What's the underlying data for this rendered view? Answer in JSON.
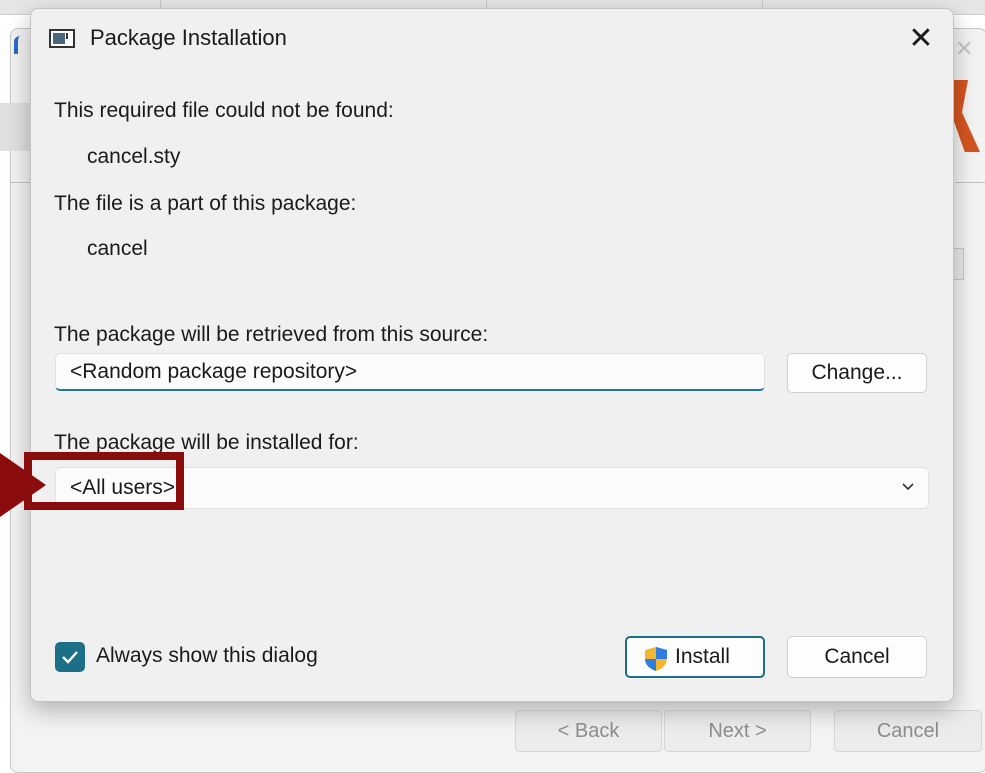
{
  "background_window": {
    "buttons": {
      "back": "< Back",
      "next": "Next >",
      "cancel": "Cancel"
    }
  },
  "dialog": {
    "title": "Package Installation",
    "close_label": "✕",
    "missing_file_label": "This required file could not be found:",
    "missing_file": "cancel.sty",
    "package_label": "The file is a part of this package:",
    "package_name": "cancel",
    "source_label": "The package will be retrieved from this source:",
    "source_value": "<Random package repository>",
    "change_button": "Change...",
    "install_for_label": "The package will be installed for:",
    "install_for_value": "<All users>",
    "always_show_label": "Always show this dialog",
    "always_show_checked": true,
    "install_button": "Install",
    "cancel_button": "Cancel"
  },
  "colors": {
    "accent": "#1b6f86",
    "highlight": "#8b0c0c"
  },
  "icons": [
    "window-icon",
    "close-icon",
    "chevron-down-icon",
    "checkmark-icon",
    "uac-shield-icon"
  ]
}
